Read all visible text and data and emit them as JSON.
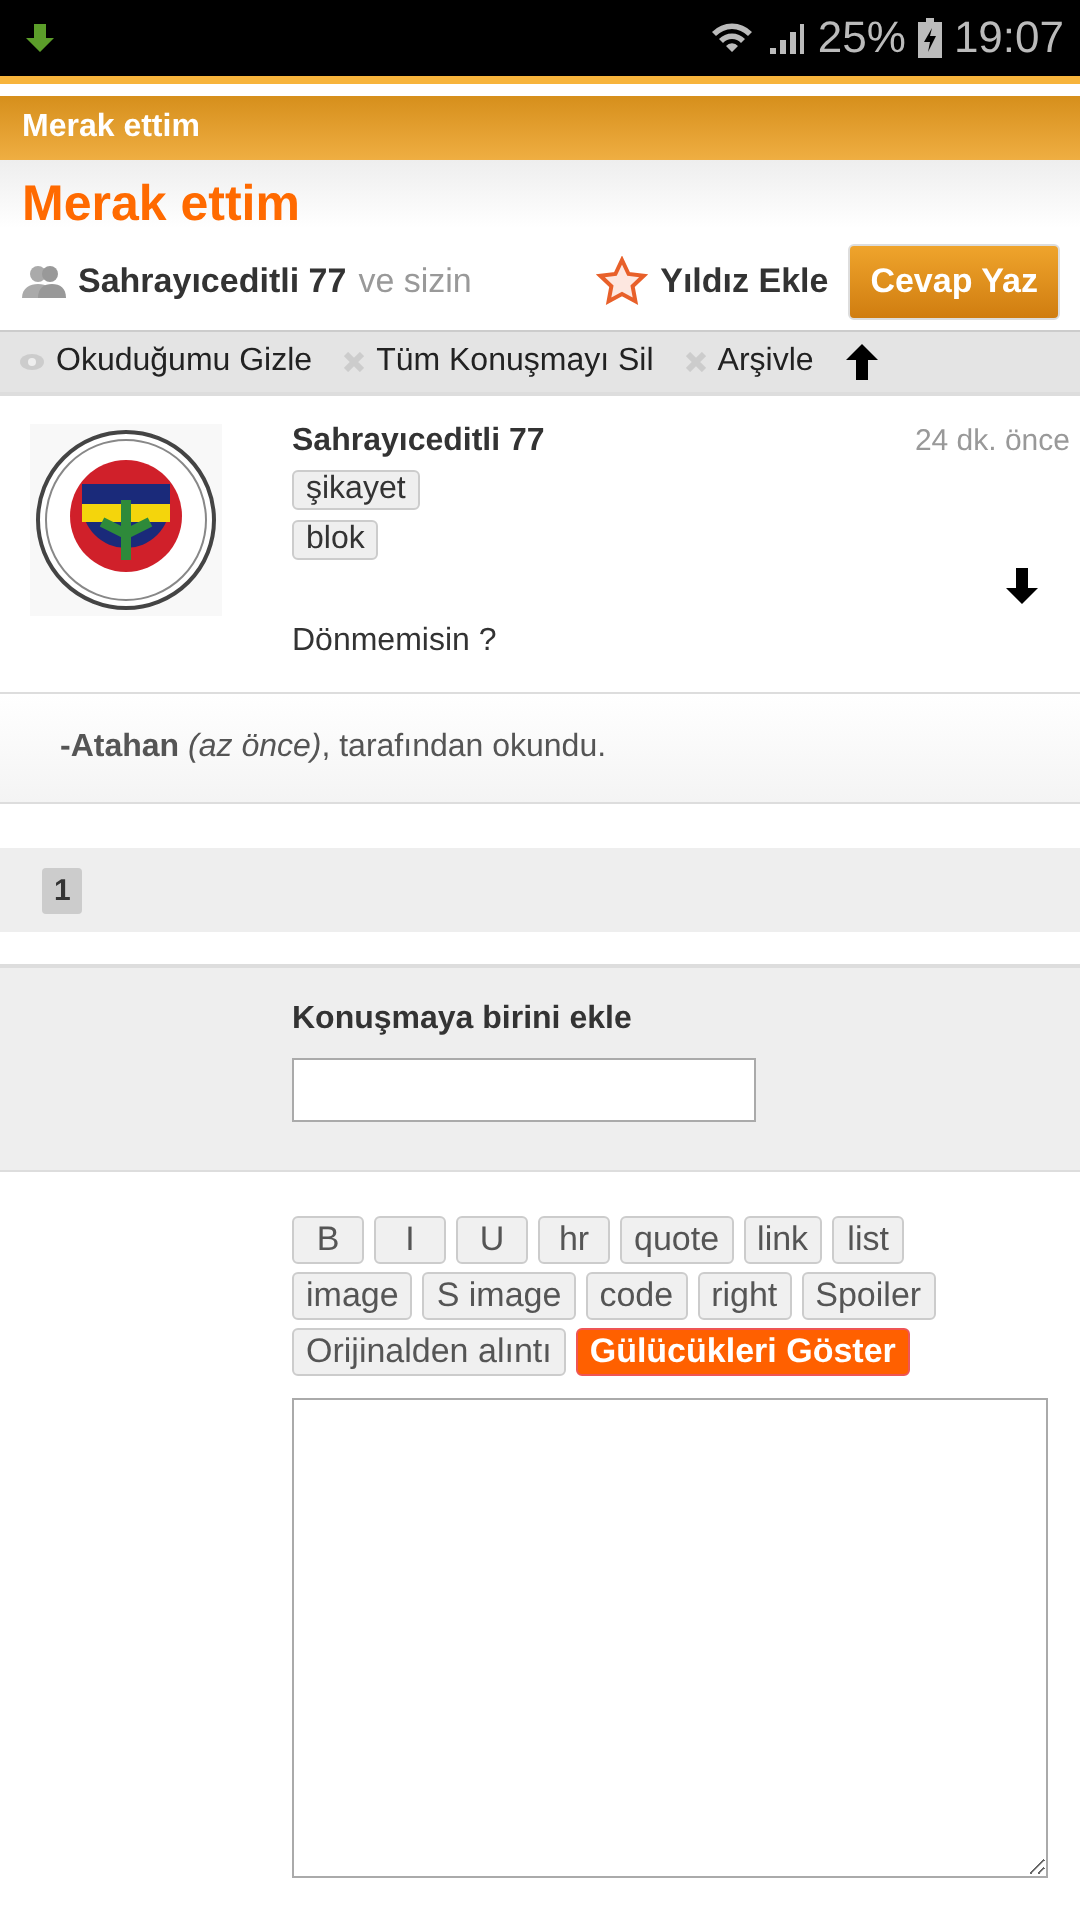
{
  "status_bar": {
    "battery": "25%",
    "time": "19:07"
  },
  "header": {
    "title": "Merak ettim"
  },
  "topic": {
    "title": "Merak ettim",
    "participant": "Sahrayıceditli 77",
    "participant_suffix": "ve sizin",
    "star_label": "Yıldız Ekle",
    "reply_button": "Cevap Yaz"
  },
  "actions": [
    {
      "label": "Okuduğumu Gizle",
      "kind": "eye"
    },
    {
      "label": "Tüm Konuşmayı Sil",
      "kind": "cross"
    },
    {
      "label": "Arşivle",
      "kind": "cross"
    }
  ],
  "message": {
    "author": "Sahrayıceditli 77",
    "time": "24 dk. önce",
    "buttons": [
      "şikayet",
      "blok"
    ],
    "text": "Dönmemisin ?"
  },
  "read_receipt": "**-Atahan** *(az önce)*, tarafından okundu.",
  "pages": [
    {
      "label": "1",
      "selected": true
    }
  ],
  "add_person": {
    "label": "Konuşmaya birini ekle"
  },
  "editor_buttons": [
    {
      "label": "B",
      "kind": "format"
    },
    {
      "label": "I",
      "kind": "format"
    },
    {
      "label": "U",
      "kind": "format"
    },
    {
      "label": "hr",
      "kind": "format"
    },
    {
      "label": "quote",
      "kind": "format"
    },
    {
      "label": "link",
      "kind": "format"
    },
    {
      "label": "list",
      "kind": "format"
    },
    {
      "label": "image",
      "kind": "format"
    },
    {
      "label": "S image",
      "kind": "format"
    },
    {
      "label": "code",
      "kind": "format"
    },
    {
      "label": "right",
      "kind": "format"
    },
    {
      "label": "Spoiler",
      "kind": "format"
    },
    {
      "label": "Orijinalden alıntı",
      "kind": "format"
    },
    {
      "label": "Gülücükleri Göster",
      "kind": "accent"
    }
  ]
}
